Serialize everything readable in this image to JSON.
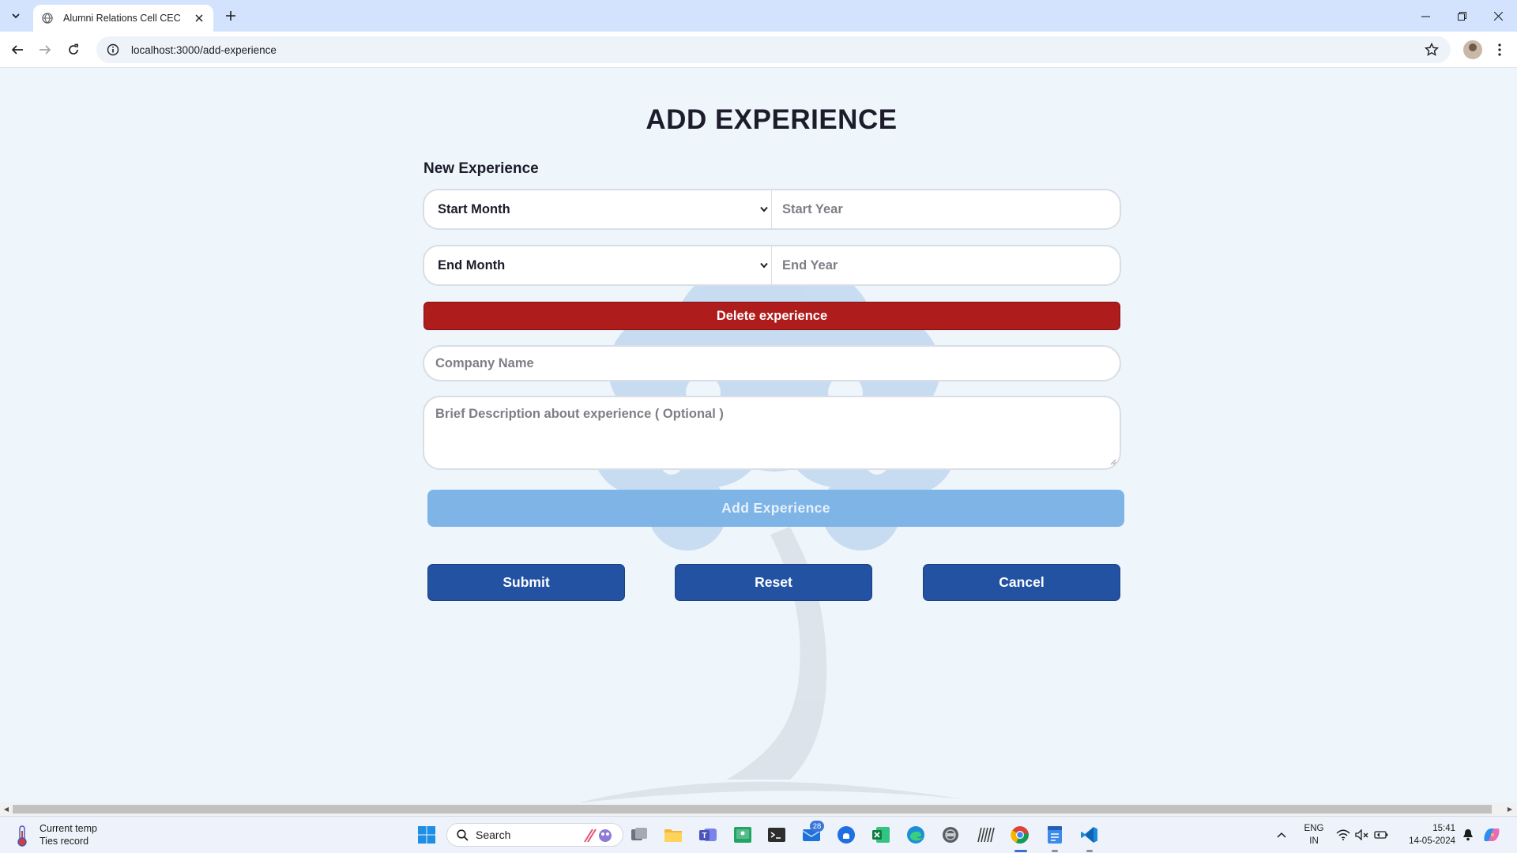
{
  "browser": {
    "tab_title": "Alumni Relations Cell CEC",
    "url": "localhost:3000/add-experience"
  },
  "page": {
    "title": "ADD EXPERIENCE",
    "section_title": "New Experience",
    "start_month": "Start Month",
    "start_year_placeholder": "Start Year",
    "end_month": "End Month",
    "end_year_placeholder": "End Year",
    "delete_label": "Delete experience",
    "company_placeholder": "Company Name",
    "description_placeholder": "Brief Description about experience ( Optional )",
    "add_label": "Add Experience",
    "submit_label": "Submit",
    "reset_label": "Reset",
    "cancel_label": "Cancel"
  },
  "taskbar": {
    "weather_title": "Current temp",
    "weather_sub": "Ties record",
    "search_label": "Search",
    "mail_badge": "28",
    "lang_1": "ENG",
    "lang_2": "IN",
    "time": "15:41",
    "date": "14-05-2024"
  },
  "colors": {
    "page_bg": "#eef5fb",
    "delete": "#af1c1c",
    "add": "#7fb4e6",
    "primary": "#2352a3"
  }
}
